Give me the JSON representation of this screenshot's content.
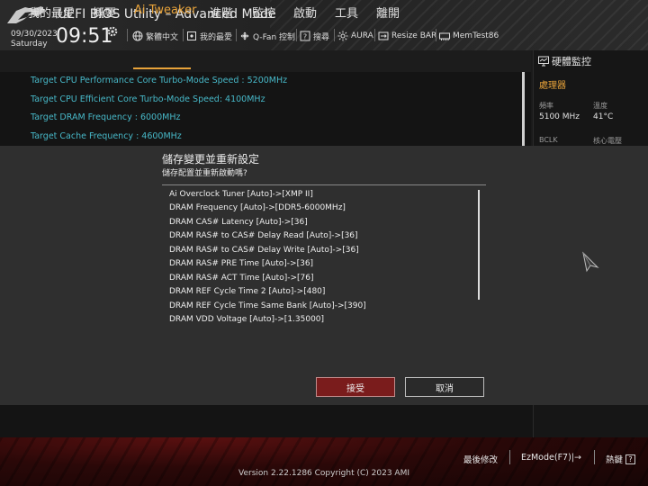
{
  "header": {
    "title": "UEFI BIOS Utility – Advanced Mode",
    "date": "09/30/2023",
    "weekday": "Saturday",
    "time": "09:51",
    "items": [
      {
        "label": "繁體中文",
        "icon": "globe-icon"
      },
      {
        "label": "我的最愛",
        "icon": "favorite-icon"
      },
      {
        "label": "Q-Fan 控制",
        "icon": "fan-icon"
      },
      {
        "label": "搜尋",
        "icon": "search-help-icon"
      },
      {
        "label": "AURA",
        "icon": "aura-icon"
      },
      {
        "label": "Resize BAR",
        "icon": "resize-bar-icon"
      },
      {
        "label": "MemTest86",
        "icon": "memtest-icon"
      }
    ]
  },
  "menu": {
    "tabs": [
      "我的最愛",
      "概要",
      "Ai Tweaker",
      "進階",
      "監控",
      "啟動",
      "工具",
      "離開"
    ],
    "active": "Ai Tweaker"
  },
  "settings": [
    "Target CPU Performance Core Turbo-Mode Speed : 5200MHz",
    "Target CPU Efficient Core Turbo-Mode Speed: 4100MHz",
    "Target DRAM Frequency : 6000MHz",
    "Target Cache Frequency : 4600MHz"
  ],
  "hw_monitor": {
    "title": "硬體監控",
    "category": "處理器",
    "freq_label": "頻率",
    "temp_label": "溫度",
    "freq_value": "5100 MHz",
    "temp_value": "41°C",
    "bclk_label": "BCLK",
    "vcore_label": "核心電壓"
  },
  "dialog": {
    "title": "儲存變更並重新設定",
    "subtitle": "儲存配置並重新啟動嗎?",
    "changes": [
      "Ai Overclock Tuner [Auto]->[XMP II]",
      "DRAM Frequency [Auto]->[DDR5-6000MHz]",
      "DRAM CAS# Latency [Auto]->[36]",
      "DRAM RAS# to CAS# Delay Read [Auto]->[36]",
      "DRAM RAS# to CAS# Delay Write [Auto]->[36]",
      "DRAM RAS# PRE Time [Auto]->[36]",
      "DRAM RAS# ACT Time [Auto]->[76]",
      "DRAM REF Cycle Time 2 [Auto]->[480]",
      "DRAM REF Cycle Time Same Bank [Auto]->[390]",
      "DRAM VDD Voltage [Auto]->[1.35000]"
    ],
    "accept": "接受",
    "cancel": "取消"
  },
  "footer": {
    "last_modified": "最後修改",
    "ezmode": "EzMode(F7)|→",
    "hotkeys": "熱鍵",
    "hotkeys_key": "?",
    "version": "Version 2.22.1286 Copyright (C) 2023 AMI"
  },
  "colors": {
    "accent": "#e8a33a",
    "setting_text": "#47b8c8",
    "accept_button": "#7a1c1c"
  }
}
